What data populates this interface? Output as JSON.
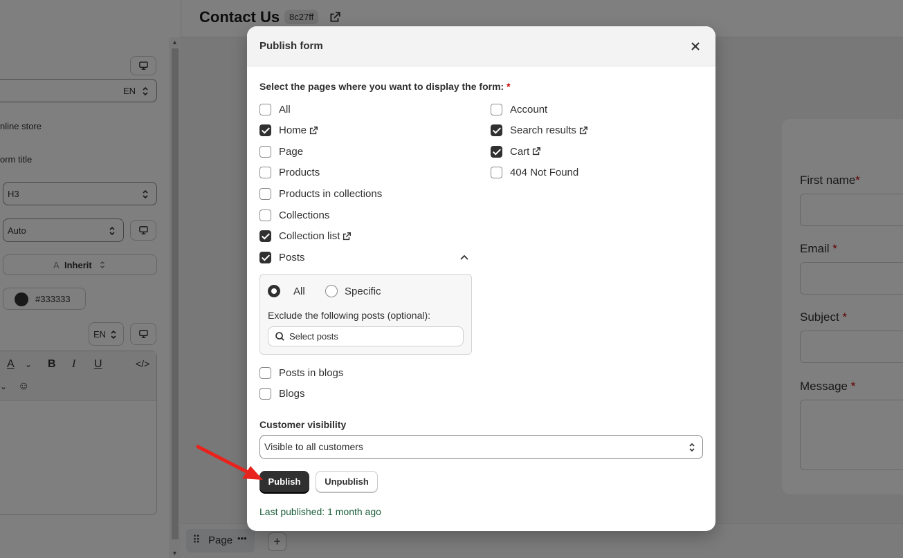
{
  "page": {
    "title": "Contact Us",
    "id_badge": "8c27ff"
  },
  "left_panel": {
    "lang_1": "EN",
    "text_online_store": "nline store",
    "text_form_title": "orm title",
    "heading_select": "H3",
    "width_select": "Auto",
    "font_select": "Inherit",
    "font_prefix": "A",
    "color_value": "#333333",
    "lang_2": "EN"
  },
  "preview": {
    "fields": [
      {
        "label": "First name",
        "required": "*"
      },
      {
        "label": "Email",
        "required": "*"
      },
      {
        "label": "Subject",
        "required": "*"
      },
      {
        "label": "Message",
        "required": "*"
      }
    ]
  },
  "bottom_bar": {
    "page_tab": "Page",
    "page_tab_menu": "•••",
    "add_label": "+"
  },
  "modal": {
    "title": "Publish form",
    "pages_prompt": "Select the pages where you want to display the form:",
    "pages_required": "*",
    "pages_left": [
      {
        "label": "All",
        "checked": false,
        "external": false
      },
      {
        "label": "Home",
        "checked": true,
        "external": true
      },
      {
        "label": "Page",
        "checked": false,
        "external": false
      },
      {
        "label": "Products",
        "checked": false,
        "external": false
      },
      {
        "label": "Products in collections",
        "checked": false,
        "external": false
      },
      {
        "label": "Collections",
        "checked": false,
        "external": false
      },
      {
        "label": "Collection list",
        "checked": true,
        "external": true
      },
      {
        "label": "Posts",
        "checked": true,
        "external": false
      }
    ],
    "pages_right": [
      {
        "label": "Account",
        "checked": false,
        "external": false
      },
      {
        "label": "Search results",
        "checked": true,
        "external": true
      },
      {
        "label": "Cart",
        "checked": true,
        "external": true
      },
      {
        "label": "404 Not Found",
        "checked": false,
        "external": false
      }
    ],
    "posts_options": {
      "radio_all": "All",
      "radio_specific": "Specific",
      "selected": "All",
      "exclude_label": "Exclude the following posts (optional):",
      "select_posts": "Select posts"
    },
    "pages_after": [
      {
        "label": "Posts in blogs",
        "checked": false
      },
      {
        "label": "Blogs",
        "checked": false
      }
    ],
    "visibility_label": "Customer visibility",
    "visibility_value": "Visible to all customers",
    "publish_label": "Publish",
    "unpublish_label": "Unpublish",
    "last_published": "Last published: 1 month ago"
  },
  "colors": {
    "accent_dark": "#303030",
    "required_red": "#c40000",
    "success_text": "#1b5e3a",
    "annotation_arrow": "#e8231d"
  }
}
